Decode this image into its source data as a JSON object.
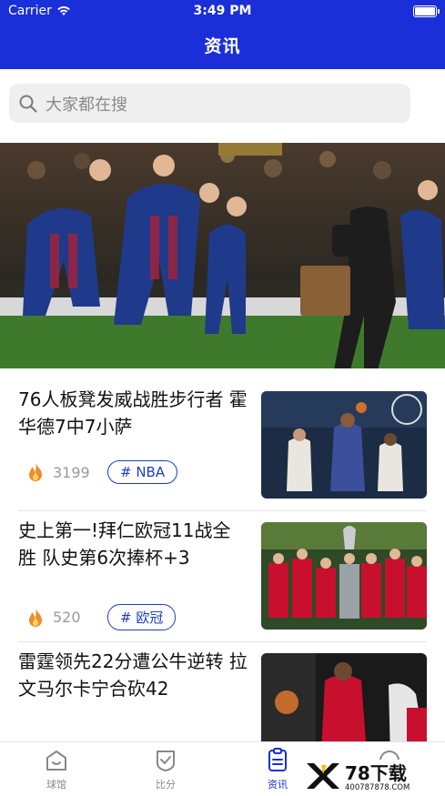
{
  "status": {
    "carrier": "Carrier",
    "time": "3:49 PM"
  },
  "header": {
    "title": "资讯"
  },
  "search": {
    "placeholder": "大家都在搜"
  },
  "banner": {
    "alt": "banner"
  },
  "news": [
    {
      "title": "76人板凳发威战胜步行者 霍华德7中7小萨",
      "views": "3199",
      "tag": "# NBA"
    },
    {
      "title": "史上第一!拜仁欧冠11战全胜 队史第6次捧杯+3",
      "views": "520",
      "tag": "# 欧冠"
    },
    {
      "title": "雷霆领先22分遭公牛逆转 拉文马尔卡宁合砍42",
      "views": "",
      "tag": ""
    }
  ],
  "tabbar": {
    "items": [
      {
        "label": "球馆"
      },
      {
        "label": "比分"
      },
      {
        "label": "资讯"
      },
      {
        "label": ""
      }
    ]
  },
  "watermark": {
    "text": "78下载",
    "url": "400787878.COM"
  },
  "colors": {
    "primary": "#1a2fd8",
    "tag": "#1f3dc2",
    "fire": "#f08c2a"
  }
}
